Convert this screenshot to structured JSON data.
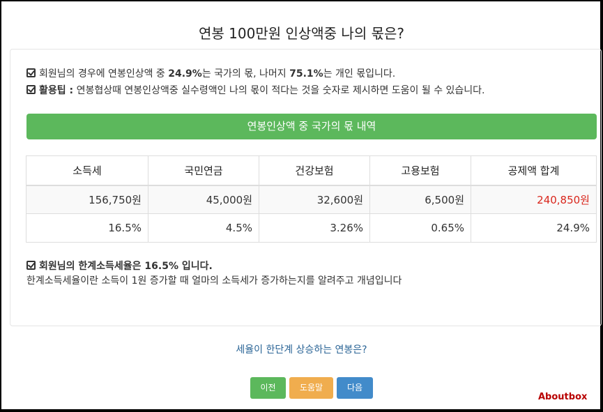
{
  "title": "연봉 100만원 인상액중 나의 몫은?",
  "info": {
    "l1_a": "회원님의 경우에 연봉인상액 중 ",
    "l1_b": "24.9%",
    "l1_c": "는 국가의 몫, 나머지 ",
    "l1_d": "75.1%",
    "l1_e": "는 개인 몫입니다.",
    "l2_a": "활용팁 :",
    "l2_b": " 연봉협상때 연봉인상액중 실수령액인 나의 몫이 적다는 것을 숫자로 제시하면 도움이 될 수 있습니다."
  },
  "section_bar": "연봉인상액 중 국가의 몫 내역",
  "table": {
    "headers": [
      "소득세",
      "국민연금",
      "건강보험",
      "고용보험",
      "공제액 합계"
    ],
    "amounts": [
      "156,750원",
      "45,000원",
      "32,600원",
      "6,500원",
      "240,850원"
    ],
    "rates": [
      "16.5%",
      "4.5%",
      "3.26%",
      "0.65%",
      "24.9%"
    ]
  },
  "marginal": {
    "heading": "회원님의 한계소득세율은 16.5% 입니다.",
    "desc": "한계소득세율이란 소득이 1원 증가할 때 얼마의 소득세가 증가하는지를 알려주고 개념입니다"
  },
  "link_text": "세율이 한단계 상승하는 연봉은?",
  "buttons": {
    "prev": "이전",
    "help": "도움말",
    "next": "다음"
  },
  "brand": "Aboutbox",
  "colors": {
    "green": "#5cb85c",
    "orange": "#f0ad4e",
    "blue": "#428bca",
    "red": "#d9261c"
  }
}
